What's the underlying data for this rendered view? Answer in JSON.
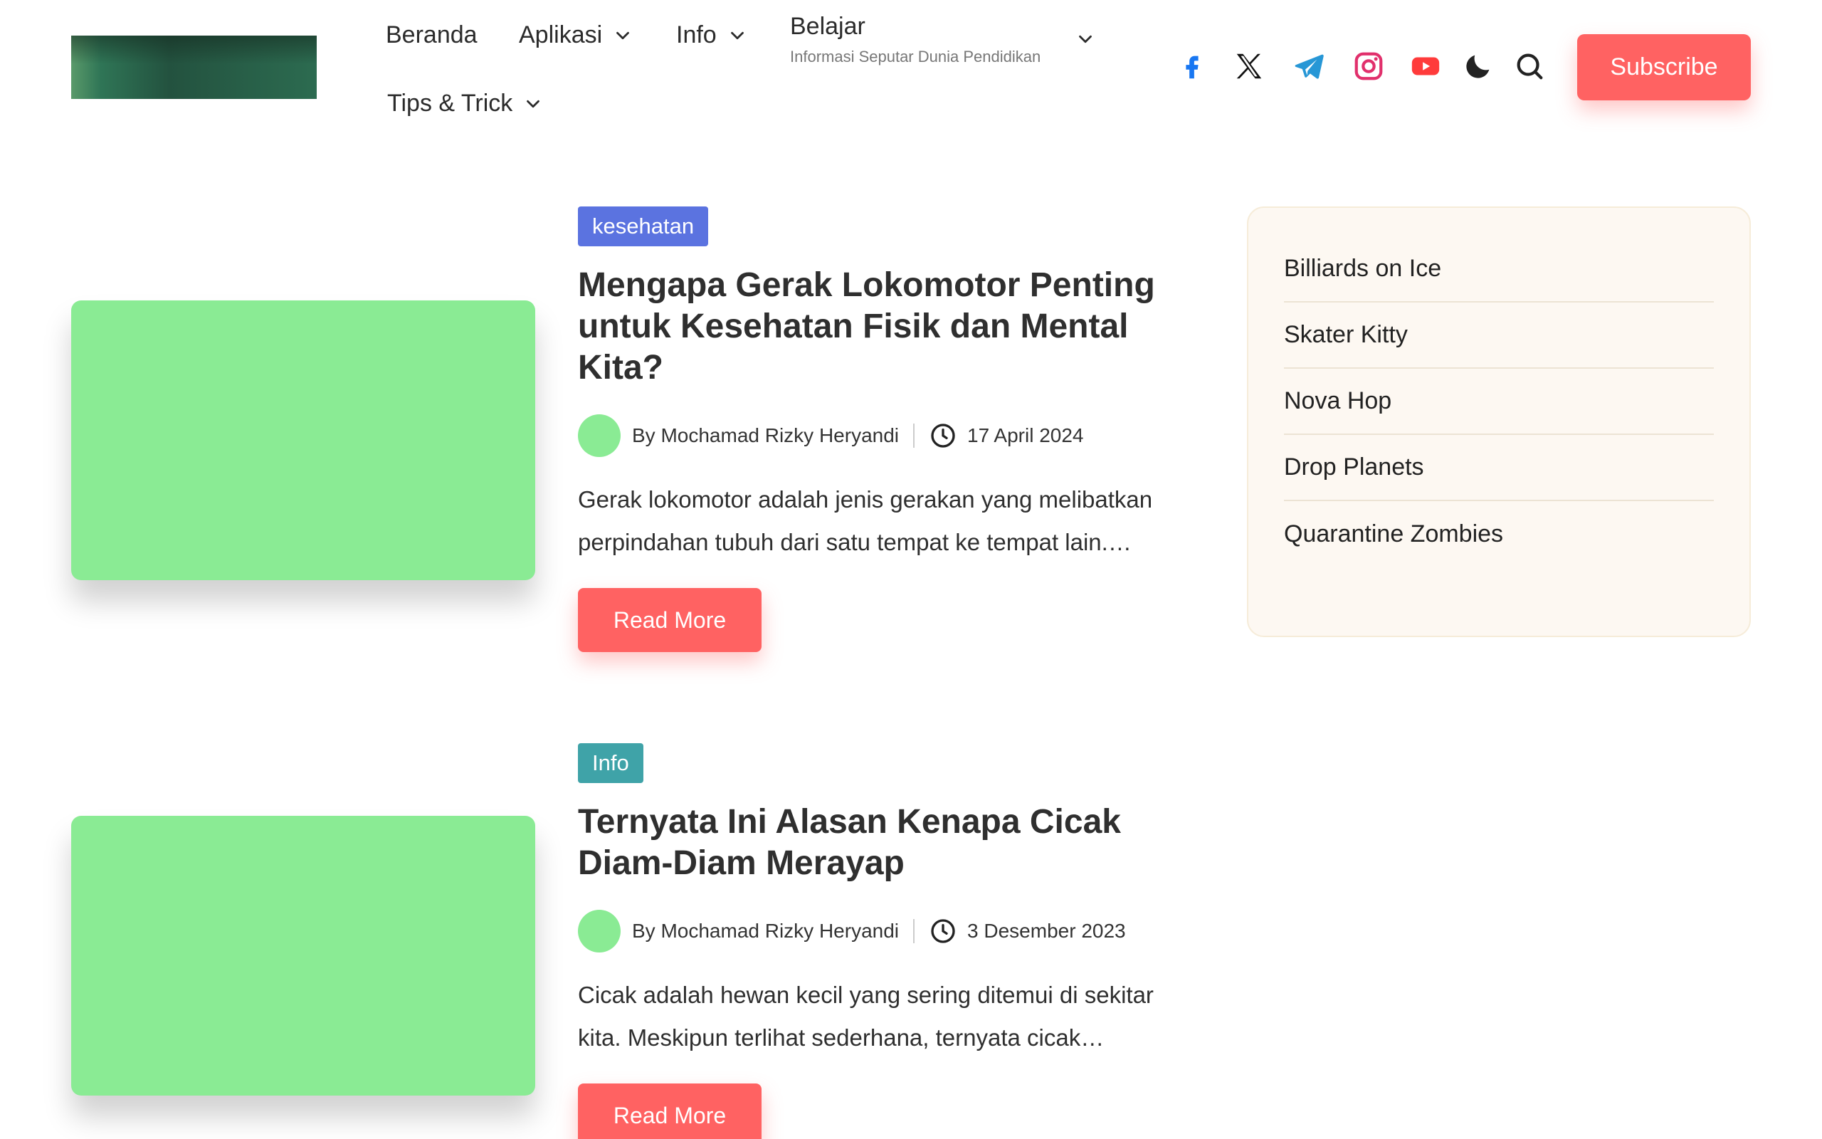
{
  "nav": {
    "items": [
      {
        "label": "Beranda"
      },
      {
        "label": "Aplikasi"
      },
      {
        "label": "Info"
      },
      {
        "label": "Belajar",
        "subtitle": "Informasi Seputar Dunia Pendidikan"
      },
      {
        "label": "Tips & Trick"
      }
    ],
    "subscribe_label": "Subscribe"
  },
  "icons": [
    "facebook-icon",
    "x-icon",
    "telegram-icon",
    "instagram-icon",
    "youtube-icon",
    "moon-icon",
    "search-icon"
  ],
  "colors": {
    "accent": "#ff6262",
    "badge_kesehatan": "#5b73e0",
    "badge_info": "#3fa3a8",
    "thumb": "#8aeb94",
    "sidebar_bg": "#fdf8f2"
  },
  "posts": [
    {
      "category": "kesehatan",
      "title": "Mengapa Gerak Lokomotor Penting untuk Kesehatan Fisik dan Mental Kita?",
      "author": "By Mochamad Rizky Heryandi",
      "date": "17 April 2024",
      "excerpt": "Gerak lokomotor adalah jenis gerakan yang melibatkan perpindahan tubuh dari satu tempat ke tempat lain.…",
      "read_more": "Read More"
    },
    {
      "category": "Info",
      "title": "Ternyata Ini Alasan Kenapa Cicak Diam-Diam Merayap",
      "author": "By Mochamad Rizky Heryandi",
      "date": "3 Desember 2023",
      "excerpt": "Cicak adalah hewan kecil yang sering ditemui di sekitar kita. Meskipun terlihat sederhana, ternyata cicak…",
      "read_more": "Read More"
    }
  ],
  "sidebar": {
    "items": [
      {
        "label": "Billiards on Ice"
      },
      {
        "label": "Skater Kitty"
      },
      {
        "label": "Nova Hop"
      },
      {
        "label": "Drop Planets"
      },
      {
        "label": "Quarantine Zombies"
      }
    ]
  }
}
